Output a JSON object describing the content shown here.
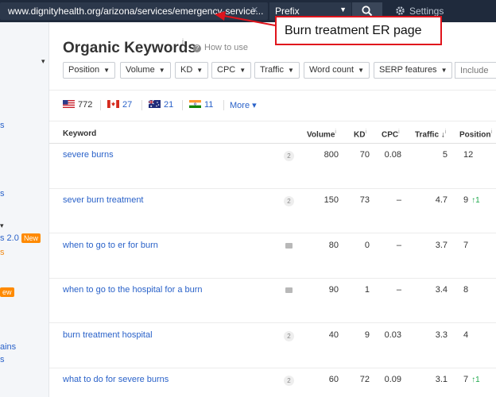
{
  "topbar": {
    "url": "www.dignityhealth.org/arizona/services/emergency-service...",
    "mode": "Prefix",
    "settings_label": "Settings"
  },
  "sidebar": {
    "items": [
      {
        "text": "▾"
      },
      {
        "text": "s"
      },
      {
        "text": "s"
      },
      {
        "text": "▾"
      },
      {
        "text": "s 2.0"
      },
      {
        "text": "New"
      },
      {
        "text": "s"
      },
      {
        "text": "ew"
      },
      {
        "text": "ains"
      },
      {
        "text": "s"
      }
    ]
  },
  "header": {
    "title": "Organic Keywords",
    "title_info": "i",
    "how_to": "How to use"
  },
  "filters": {
    "buttons": [
      "Position",
      "Volume",
      "KD",
      "CPC",
      "Traffic",
      "Word count",
      "SERP features"
    ],
    "include_placeholder": "Include"
  },
  "countries": [
    {
      "code": "US",
      "count": "772"
    },
    {
      "code": "CA",
      "count": "27"
    },
    {
      "code": "AU",
      "count": "21"
    },
    {
      "code": "IN",
      "count": "11"
    }
  ],
  "more_label": "More ▾",
  "table": {
    "headers": {
      "keyword": "Keyword",
      "volume": "Volume",
      "kd": "KD",
      "cpc": "CPC",
      "traffic": "Traffic ↓",
      "position": "Position"
    },
    "rows": [
      {
        "keyword": "severe burns",
        "serp": "2",
        "volume": "800",
        "kd": "70",
        "cpc": "0.08",
        "traffic": "5",
        "position": "12",
        "change": ""
      },
      {
        "keyword": "sever burn treatment",
        "serp": "2",
        "volume": "150",
        "kd": "73",
        "cpc": "–",
        "traffic": "4.7",
        "position": "9",
        "change": "↑1"
      },
      {
        "keyword": "when to go to er for burn",
        "serp": "",
        "volume": "80",
        "kd": "0",
        "cpc": "–",
        "traffic": "3.7",
        "position": "7",
        "change": ""
      },
      {
        "keyword": "when to go to the hospital for a burn",
        "serp": "",
        "volume": "90",
        "kd": "1",
        "cpc": "–",
        "traffic": "3.4",
        "position": "8",
        "change": ""
      },
      {
        "keyword": "burn treatment hospital",
        "serp": "2",
        "volume": "40",
        "kd": "9",
        "cpc": "0.03",
        "traffic": "3.3",
        "position": "4",
        "change": ""
      },
      {
        "keyword": "what to do for severe burns",
        "serp": "2",
        "volume": "60",
        "kd": "72",
        "cpc": "0.09",
        "traffic": "3.1",
        "position": "7",
        "change": "↑1"
      }
    ]
  },
  "annotation": {
    "text": "Burn treatment ER page",
    "color": "#e0141c"
  },
  "colors": {
    "topbar": "#1f2a3c",
    "link": "#2a62c9",
    "badge_new": "#ff8a00",
    "positive": "#1ea84b"
  }
}
